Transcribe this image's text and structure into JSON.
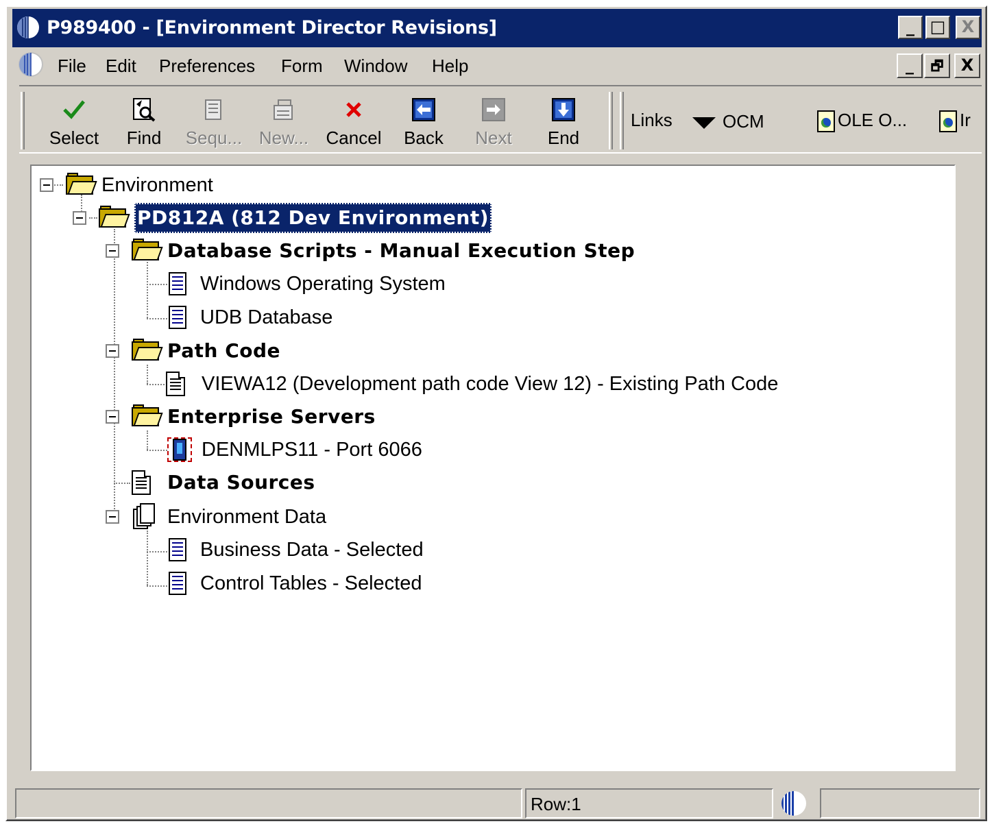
{
  "window": {
    "title": "P989400 - [Environment Director Revisions]",
    "accent_color": "#0a246a",
    "title_controls": [
      "minimize-icon",
      "maximize-icon",
      "close-icon"
    ],
    "min_glyph": "_",
    "max_glyph": "□",
    "close_glyph": "X",
    "restore_glyph": "🗗"
  },
  "menu": {
    "items": [
      {
        "label": "File",
        "accel": "F"
      },
      {
        "label": "Edit",
        "accel": "E"
      },
      {
        "label": "Preferences",
        "accel": "P"
      },
      {
        "label": "Form",
        "accel": "m"
      },
      {
        "label": "Window",
        "accel": "W"
      },
      {
        "label": "Help",
        "accel": "H"
      }
    ]
  },
  "toolbar": {
    "buttons": [
      {
        "label": "Select",
        "icon": "checkmark-icon",
        "enabled": true
      },
      {
        "label": "Find",
        "icon": "find-icon",
        "enabled": true
      },
      {
        "label": "Sequ...",
        "icon": "sequence-icon",
        "enabled": false
      },
      {
        "label": "New...",
        "icon": "new-icon",
        "enabled": false
      },
      {
        "label": "Cancel",
        "icon": "cancel-x-icon",
        "enabled": true
      },
      {
        "label": "Back",
        "icon": "back-arrow-icon",
        "enabled": true
      },
      {
        "label": "Next",
        "icon": "next-arrow-icon",
        "enabled": false
      },
      {
        "label": "End",
        "icon": "end-arrow-icon",
        "enabled": true
      }
    ],
    "links_label": "Links",
    "ocm_label": "OCM",
    "link_docs": [
      "OLE O...",
      "Ir"
    ]
  },
  "tree": {
    "environment": "Environment",
    "env_node": "PD812A (812 Dev Environment)",
    "db_scripts": "Database Scripts - Manual Execution Step",
    "windows_os": "Windows Operating System",
    "udb": "UDB Database",
    "path_code": "Path Code",
    "viewa12": "VIEWA12 (Development path code View 12) - Existing Path Code",
    "enterprise_servers": "Enterprise Servers",
    "server": "DENMLPS11 - Port 6066",
    "data_sources": "Data Sources",
    "environment_data": "Environment Data",
    "business_data": "Business Data - Selected",
    "control_tables": "Control Tables - Selected"
  },
  "status": {
    "row": "Row:1"
  }
}
